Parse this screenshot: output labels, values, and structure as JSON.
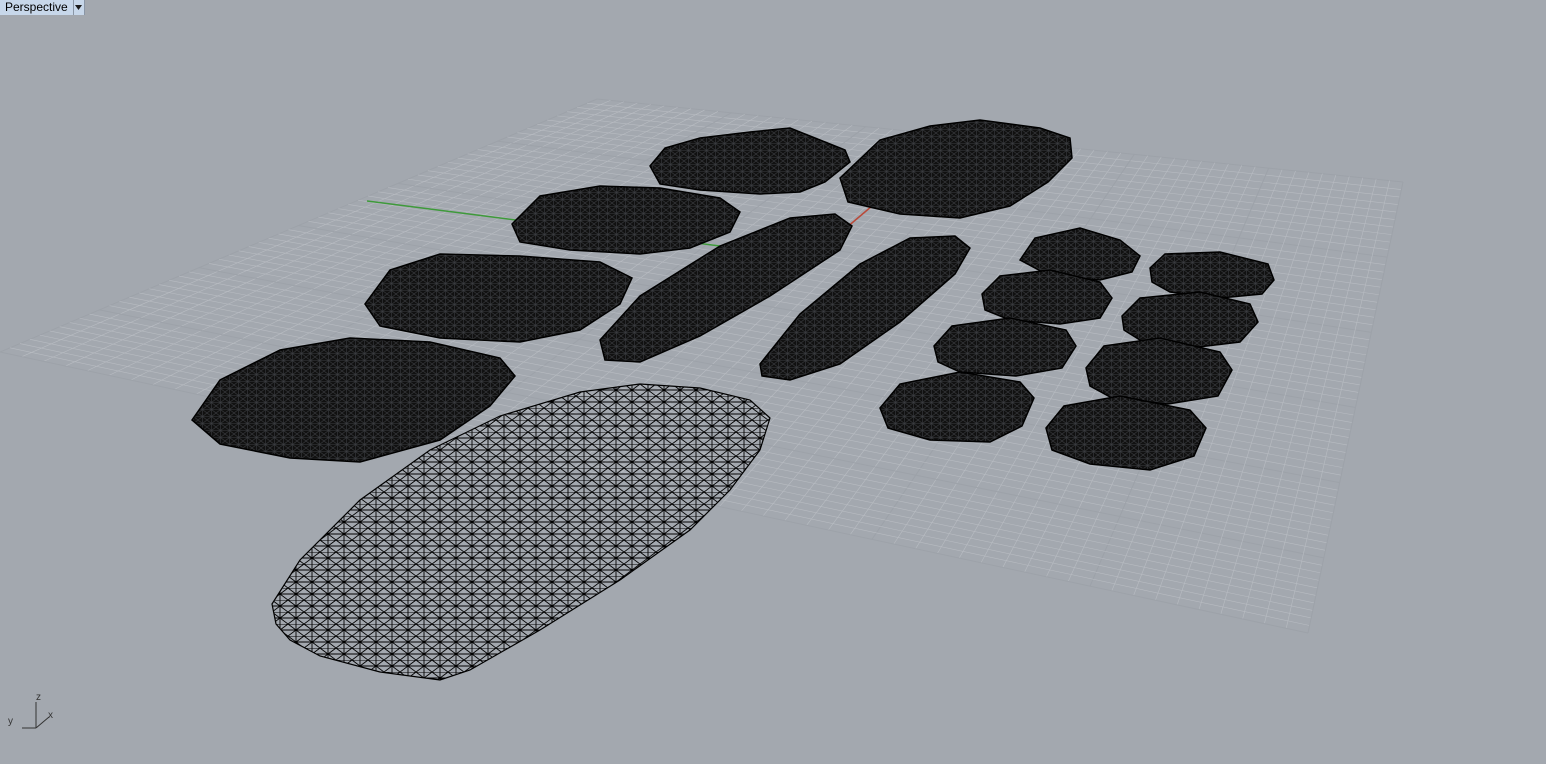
{
  "viewport": {
    "title": "Perspective",
    "dropdown_icon": "triangle-down-icon"
  },
  "axis_gizmo": {
    "z_label": "z",
    "y_label": "y",
    "x_label": "x"
  },
  "colors": {
    "background": "#a3a8af",
    "grid_minor": "#b8bcc2",
    "grid_major": "#9da2a9",
    "x_axis": "#b94a3a",
    "y_axis": "#3e9a3a",
    "mesh": "#000000",
    "title_bg": "#c7d7ea"
  }
}
